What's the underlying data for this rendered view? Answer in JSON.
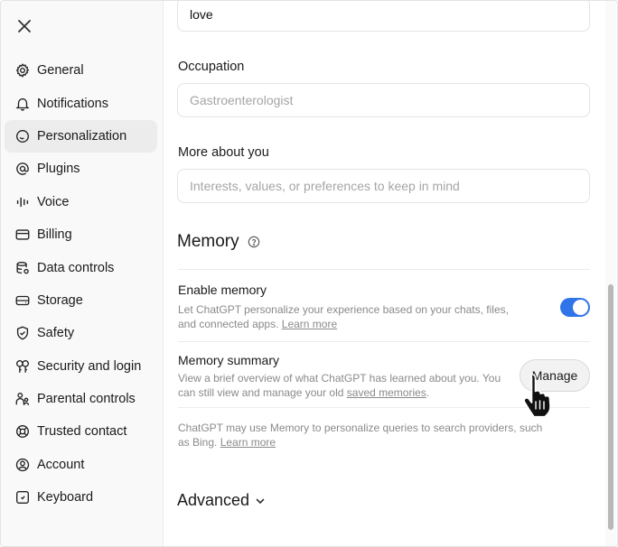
{
  "sidebar": {
    "items": [
      {
        "label": "General",
        "icon": "gear-icon",
        "active": false
      },
      {
        "label": "Notifications",
        "icon": "bell-icon",
        "active": false
      },
      {
        "label": "Personalization",
        "icon": "personalization-icon",
        "active": true
      },
      {
        "label": "Plugins",
        "icon": "at-icon",
        "active": false
      },
      {
        "label": "Voice",
        "icon": "waveform-icon",
        "active": false
      },
      {
        "label": "Billing",
        "icon": "credit-card-icon",
        "active": false
      },
      {
        "label": "Data controls",
        "icon": "database-icon",
        "active": false
      },
      {
        "label": "Storage",
        "icon": "hard-drive-icon",
        "active": false
      },
      {
        "label": "Safety",
        "icon": "shield-icon",
        "active": false
      },
      {
        "label": "Security and login",
        "icon": "key-icon",
        "active": false
      },
      {
        "label": "Parental controls",
        "icon": "parent-icon",
        "active": false
      },
      {
        "label": "Trusted contact",
        "icon": "lifebuoy-icon",
        "active": false
      },
      {
        "label": "Account",
        "icon": "user-circle-icon",
        "active": false
      },
      {
        "label": "Keyboard",
        "icon": "keyboard-icon",
        "active": false
      }
    ]
  },
  "main": {
    "top_field_value": "love",
    "occupation": {
      "label": "Occupation",
      "placeholder": "Gastroenterologist"
    },
    "more_about": {
      "label": "More about you",
      "placeholder": "Interests, values, or preferences to keep in mind"
    },
    "memory": {
      "heading": "Memory",
      "enable": {
        "title": "Enable memory",
        "desc": "Let ChatGPT personalize your experience based on your chats, files, and connected apps.",
        "link": "Learn more",
        "enabled": true
      },
      "summary": {
        "title": "Memory summary",
        "desc": "View a brief overview of what ChatGPT has learned about you. You can still view and manage your old",
        "link": "saved memories",
        "desc_end": ".",
        "button": "Manage"
      },
      "search_note": {
        "desc": "ChatGPT may use Memory to personalize queries to search providers, such as Bing.",
        "link": "Learn more"
      }
    },
    "advanced": "Advanced"
  },
  "colors": {
    "accent": "#2f74e8",
    "active_nav": "#ececec"
  }
}
